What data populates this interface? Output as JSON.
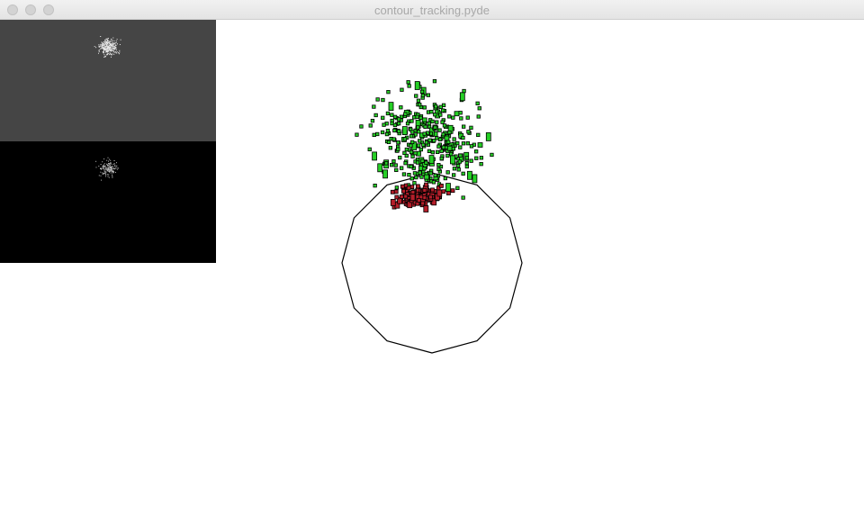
{
  "window": {
    "title": "contour_tracking.pyde",
    "buttons": [
      "close",
      "minimize",
      "zoom"
    ]
  },
  "sketch": {
    "background": "#ffffff",
    "thumbnail_gray_bg": "#454545",
    "thumbnail_black_bg": "#000000",
    "particle_colors": [
      "#26cf26",
      "#b51e2a"
    ],
    "outline_color": "#000000",
    "polygon_sides": 12
  }
}
